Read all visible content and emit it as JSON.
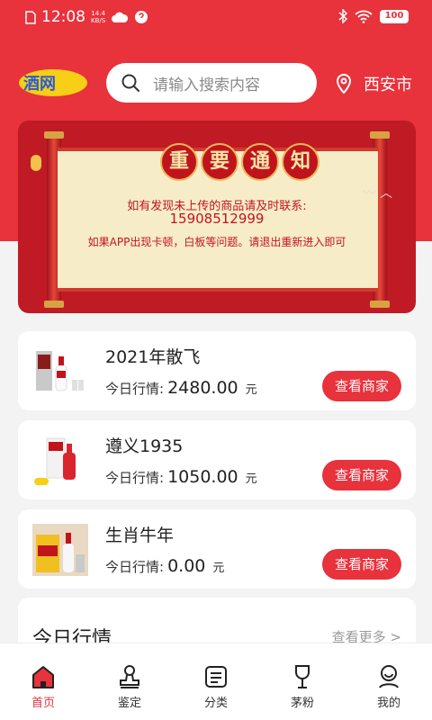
{
  "status": {
    "time": "12:08",
    "net_speed": "14.4",
    "net_unit": "KB/S",
    "battery": "100"
  },
  "header": {
    "logo_text": "酒网",
    "search_placeholder": "请输入搜索内容",
    "city": "西安市"
  },
  "banner": {
    "title_chars": [
      "重",
      "要",
      "通",
      "知"
    ],
    "line1": "如有发现未上传的商品请及时联系:",
    "phone": "15908512999",
    "line2": "如果APP出现卡顿，白板等问题。请退出重新进入即可"
  },
  "products": [
    {
      "name": "2021年散飞",
      "quote_label": "今日行情:",
      "price": "2480.00",
      "unit": "元",
      "button": "查看商家"
    },
    {
      "name": "遵义1935",
      "quote_label": "今日行情:",
      "price": "1050.00",
      "unit": "元",
      "button": "查看商家"
    },
    {
      "name": "生肖牛年",
      "quote_label": "今日行情:",
      "price": "0.00",
      "unit": "元",
      "button": "查看商家"
    }
  ],
  "market": {
    "title": "今日行情",
    "more": "查看更多 >"
  },
  "tabs": [
    {
      "label": "首页",
      "icon": "home-icon",
      "active": true
    },
    {
      "label": "鉴定",
      "icon": "stamp-icon",
      "active": false
    },
    {
      "label": "分类",
      "icon": "list-icon",
      "active": false
    },
    {
      "label": "茅粉",
      "icon": "wine-glass-icon",
      "active": false
    },
    {
      "label": "我的",
      "icon": "user-icon",
      "active": false
    }
  ],
  "colors": {
    "accent": "#e8323c",
    "background": "#f3f3f3"
  }
}
